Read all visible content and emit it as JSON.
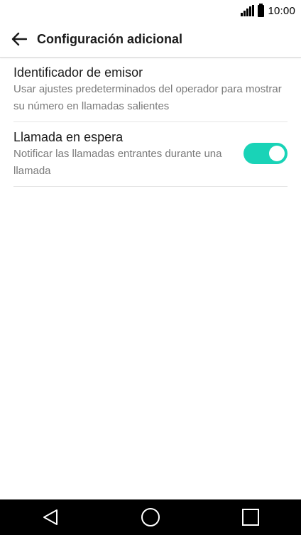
{
  "status_bar": {
    "time": "10:00",
    "signal_icon": "signal-bars-icon",
    "battery_icon": "battery-icon"
  },
  "app_bar": {
    "back_icon": "arrow-back-icon",
    "title": "Configuración adicional"
  },
  "settings": [
    {
      "title": "Identificador de emisor",
      "subtitle": "Usar ajustes predeterminados del operador para mostrar su número en llamadas salientes"
    },
    {
      "title": "Llamada en espera",
      "subtitle": "Notificar las llamadas entrantes durante una llamada",
      "toggle_on": true
    }
  ],
  "nav_bar": {
    "back_icon": "triangle-back-icon",
    "home_icon": "circle-home-icon",
    "recents_icon": "square-recents-icon"
  },
  "colors": {
    "accent": "#19d3b7",
    "nav_background": "#000000",
    "subtitle": "#7a7a7a"
  }
}
